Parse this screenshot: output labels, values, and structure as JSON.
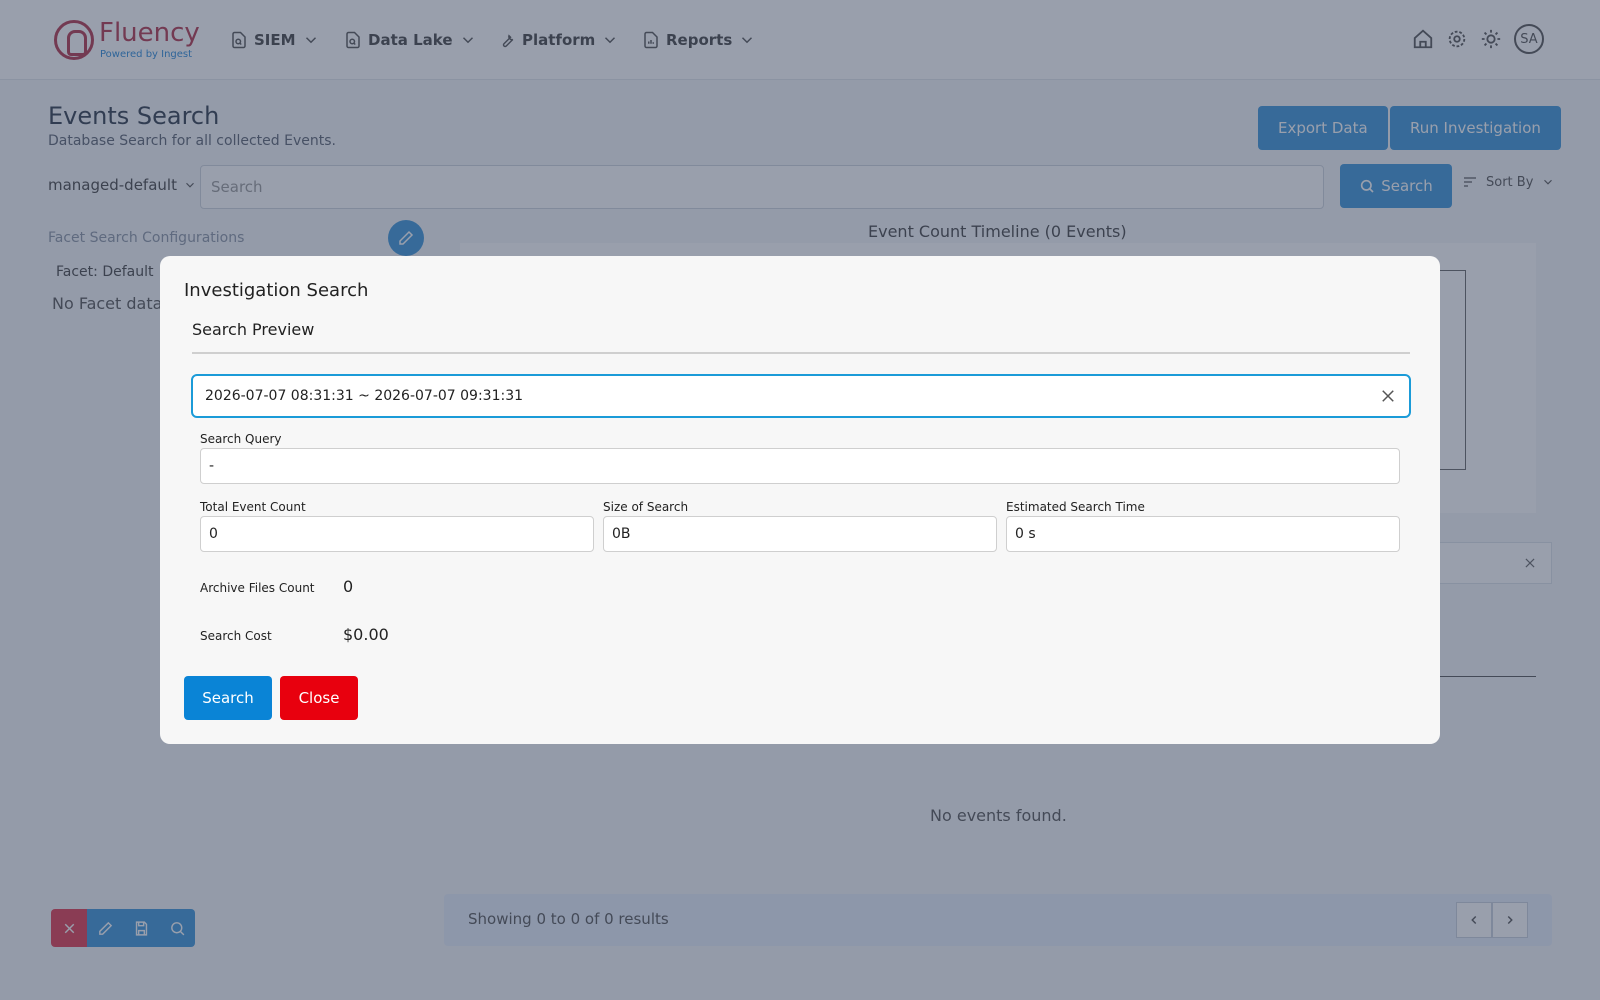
{
  "brand": {
    "name": "Fluency",
    "tagline": "Powered by Ingest",
    "color": "#b3344a"
  },
  "nav": {
    "items": [
      {
        "label": "SIEM",
        "icon": "file-search-icon"
      },
      {
        "label": "Data Lake",
        "icon": "file-search-icon"
      },
      {
        "label": "Platform",
        "icon": "wrench-icon"
      },
      {
        "label": "Reports",
        "icon": "report-icon"
      }
    ],
    "avatar": "SA"
  },
  "page": {
    "title": "Events Search",
    "subtitle": "Database Search for all collected Events.",
    "export_label": "Export Data",
    "run_label": "Run Investigation",
    "db_select": "managed-default",
    "search_placeholder": "Search",
    "search_button": "Search",
    "sort_label": "Sort By",
    "facet_title": "Facet Search Configurations",
    "facet_default": "Facet: Default",
    "facet_none": "No Facet data",
    "timeline_title": "Event Count Timeline (0 Events)",
    "no_events": "No events found.",
    "footer_text": "Showing 0 to 0 of 0 results"
  },
  "modal": {
    "title": "Investigation Search",
    "section": "Search Preview",
    "daterange": "2026-07-07 08:31:31 ~ 2026-07-07 09:31:31",
    "query_label": "Search Query",
    "query_value": "-",
    "count_label": "Total Event Count",
    "count_value": "0",
    "size_label": "Size of Search",
    "size_value": "0B",
    "time_label": "Estimated Search Time",
    "time_value": "0 s",
    "archive_label": "Archive Files Count",
    "archive_value": "0",
    "cost_label": "Search Cost",
    "cost_value": "$0.00",
    "search_button": "Search",
    "close_button": "Close"
  },
  "colors": {
    "primary": "#0a84d6",
    "danger": "#e8000e",
    "accent_focus": "#1b9bd8"
  }
}
